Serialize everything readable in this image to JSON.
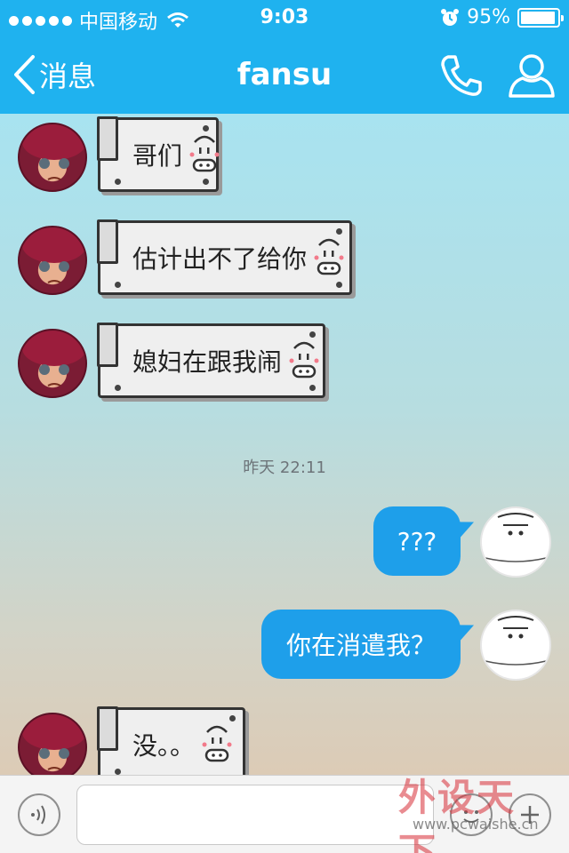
{
  "status_bar": {
    "carrier": "中国移动",
    "time": "9:03",
    "battery": "95%",
    "battery_level": 0.95
  },
  "nav": {
    "back_label": "消息",
    "title": "fansu"
  },
  "messages": {
    "m1": "哥们",
    "m2": "估计出不了给你",
    "m3": "媳妇在跟我闹",
    "timestamp": "昨天 22:11",
    "m4": "???",
    "m5": "你在消遣我？",
    "m6": "没。。"
  },
  "input": {
    "placeholder": ""
  },
  "watermark": {
    "logo": "外设天下",
    "url": "www.pcwaishe.cn"
  },
  "colors": {
    "header": "#1fb2ef",
    "sent_bubble": "#1e9fea"
  }
}
